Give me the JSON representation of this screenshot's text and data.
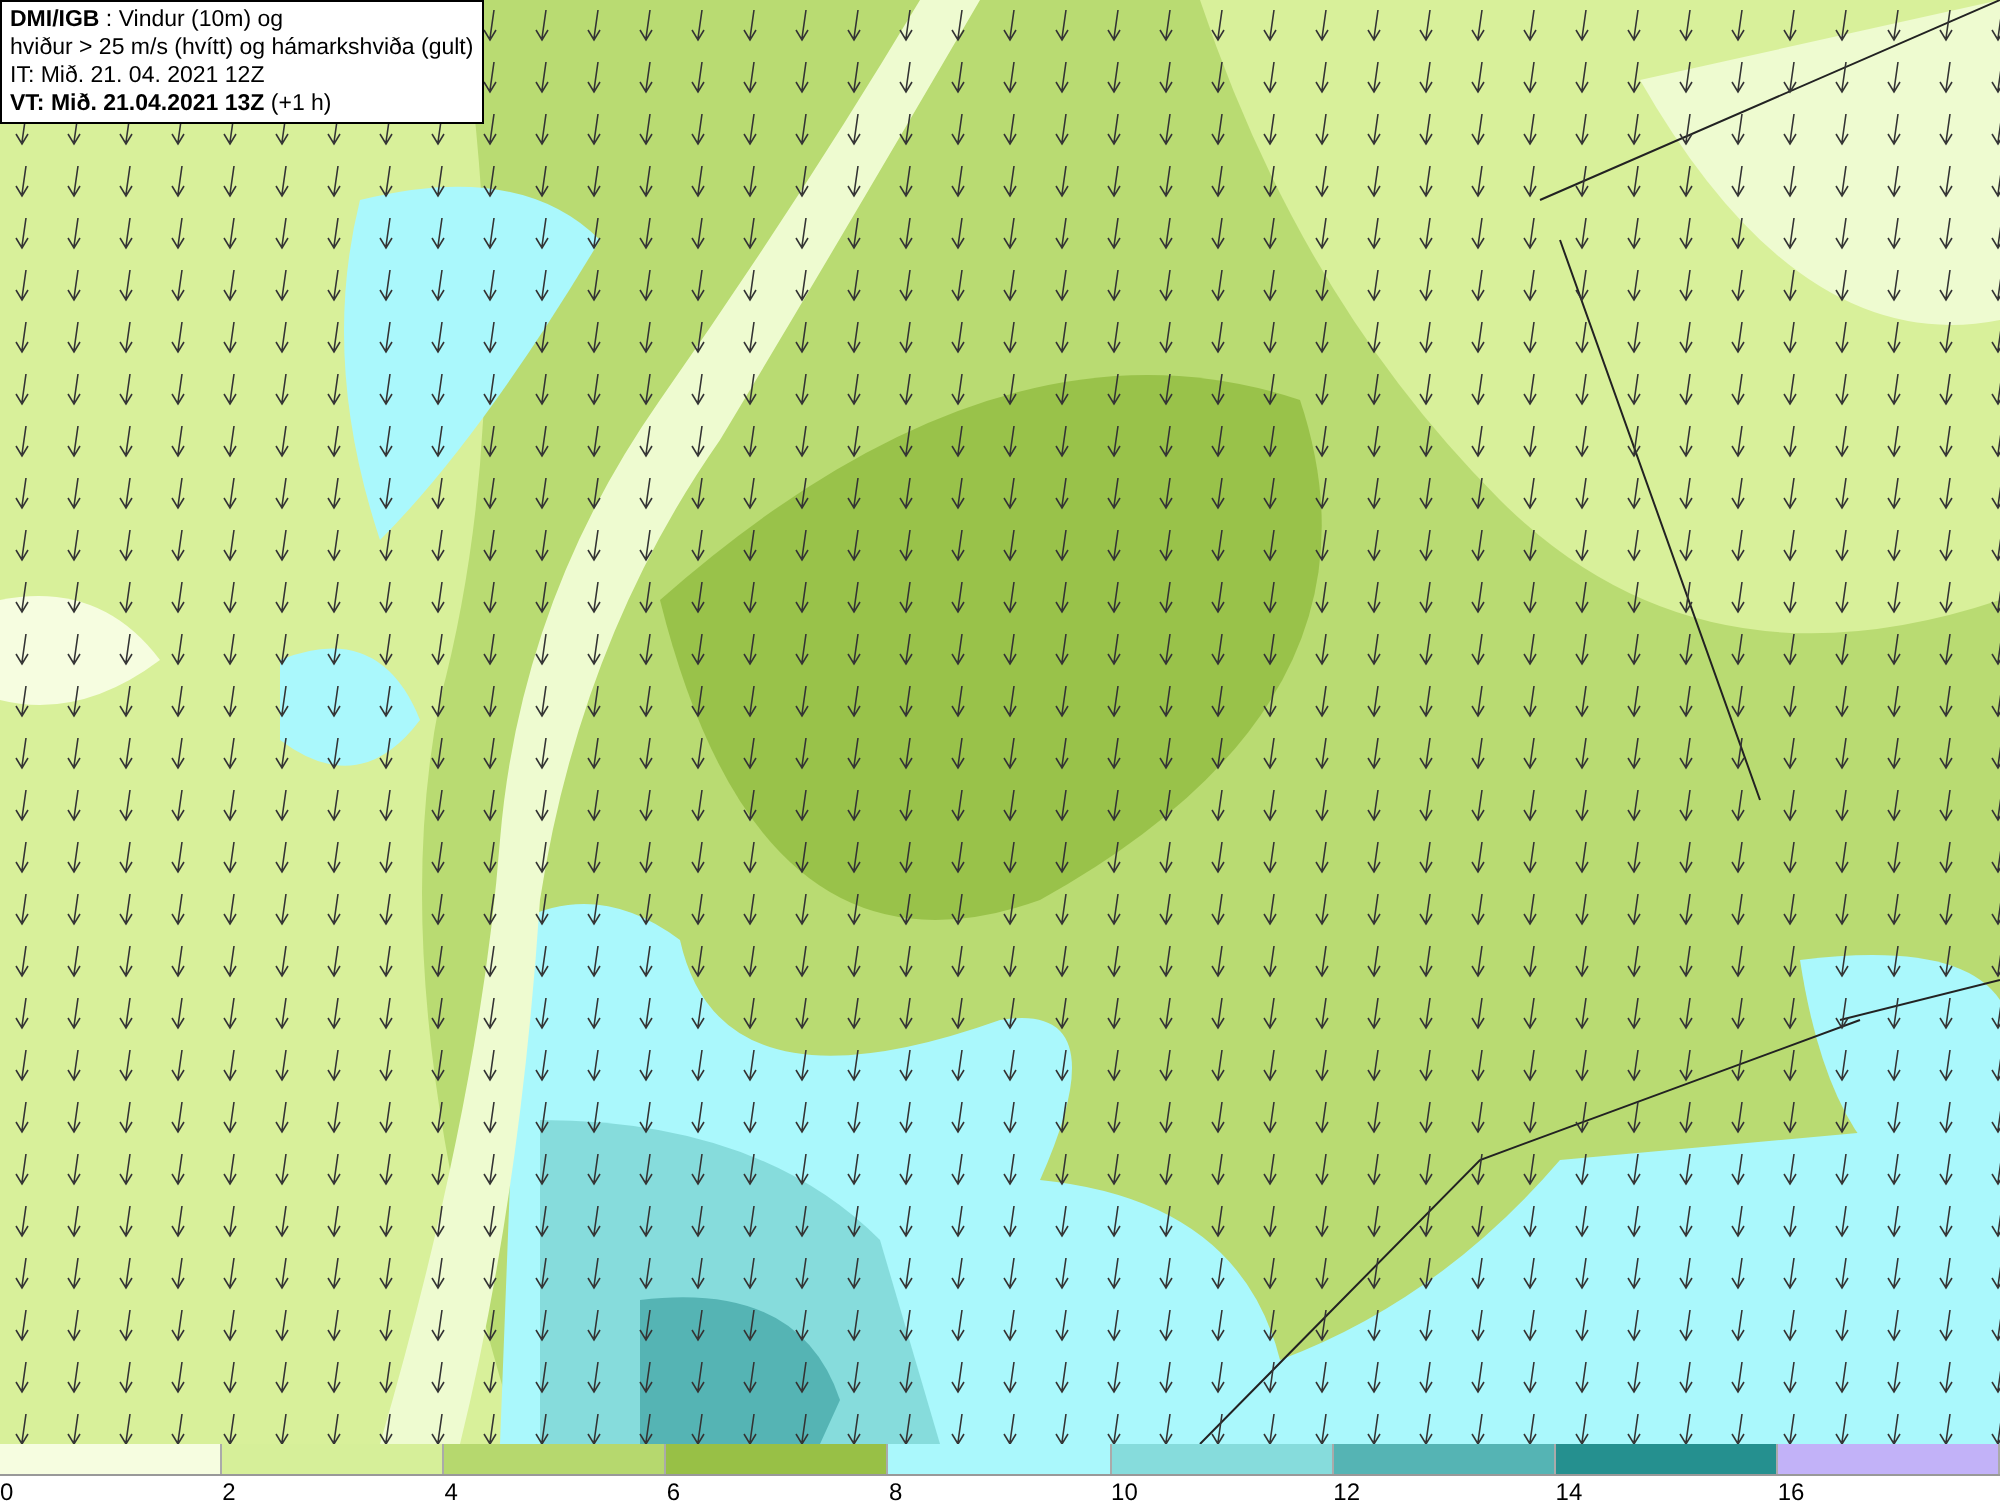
{
  "title_box": {
    "lines": [
      "**DMI/IGB** : Vindur (10m) og",
      "hviður > 25 m/s (hvítt) og hámarkshviða (gult)",
      "IT: Mið. 21. 04. 2021 12Z",
      "**VT: Mið. 21.04.2021 13Z** (+1 h)"
    ]
  },
  "legend": {
    "bins": [
      {
        "color": "#f6fde0"
      },
      {
        "color": "#d6ef99"
      },
      {
        "color": "#b6d86e"
      },
      {
        "color": "#98c046"
      },
      {
        "color": "#aaf8fc"
      },
      {
        "color": "#86dcdc"
      },
      {
        "color": "#55b4b4"
      },
      {
        "color": "#25908f"
      },
      {
        "color": "#c2b2f8"
      }
    ],
    "ticks": [
      "0",
      "2",
      "4",
      "6",
      "8",
      "10",
      "12",
      "14",
      "16"
    ]
  }
}
